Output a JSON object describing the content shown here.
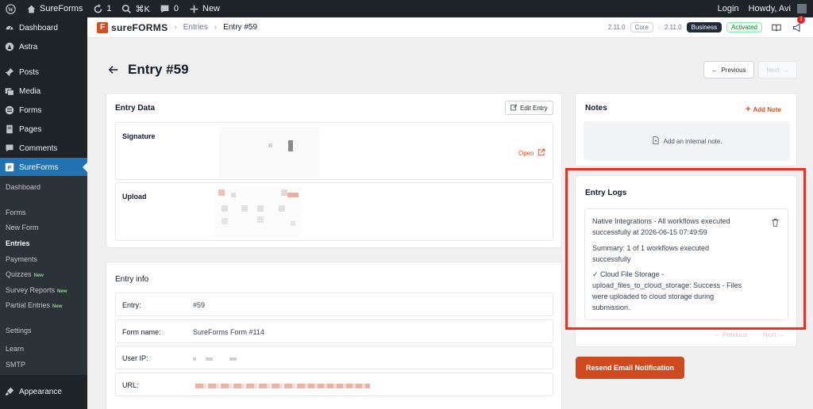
{
  "admin_bar": {
    "site_name": "SureForms",
    "updates_count": "1",
    "search_shortcut": "⌘K",
    "comments_count": "0",
    "new_label": "New",
    "login_label": "Login",
    "howdy_label": "Howdy, Avi"
  },
  "sidebar": {
    "items": [
      {
        "label": "Dashboard",
        "icon": "dashboard-icon"
      },
      {
        "label": "Astra",
        "icon": "astra-icon"
      },
      {
        "label": "Posts",
        "icon": "pin-icon"
      },
      {
        "label": "Media",
        "icon": "media-icon"
      },
      {
        "label": "Forms",
        "icon": "forms-icon"
      },
      {
        "label": "Pages",
        "icon": "pages-icon"
      },
      {
        "label": "Comments",
        "icon": "comments-icon"
      },
      {
        "label": "SureForms",
        "icon": "sureforms-icon"
      }
    ],
    "submenu": [
      {
        "label": "Dashboard",
        "new": ""
      },
      {
        "label": "Forms",
        "new": ""
      },
      {
        "label": "New Form",
        "new": ""
      },
      {
        "label": "Entries",
        "new": ""
      },
      {
        "label": "Payments",
        "new": ""
      },
      {
        "label": "Quizzes",
        "new": "New"
      },
      {
        "label": "Survey Reports",
        "new": "New"
      },
      {
        "label": "Partial Entries",
        "new": "New"
      },
      {
        "label": "Settings",
        "new": ""
      },
      {
        "label": "Learn",
        "new": ""
      },
      {
        "label": "SMTP",
        "new": ""
      }
    ],
    "bottom": {
      "label": "Appearance",
      "icon": "appearance-icon"
    }
  },
  "header": {
    "logo_text": "sureFORMS",
    "breadcrumbs": [
      "Entries",
      "Entry #59"
    ],
    "version_core": "2.11.0",
    "core_label": "Core",
    "version_business": "2.11.0",
    "business_label": "Business",
    "activated_label": "Activated",
    "notification_count": "1"
  },
  "page": {
    "title": "Entry #59",
    "previous_label": "Previous",
    "next_label": "Next"
  },
  "entry_data": {
    "title": "Entry Data",
    "edit_label": "Edit Entry",
    "signature_label": "Signature",
    "open_label": "Open",
    "upload_label": "Upload"
  },
  "entry_info": {
    "title": "Entry info",
    "rows": [
      {
        "label": "Entry:",
        "value": "#59"
      },
      {
        "label": "Form name:",
        "value": "SureForms Form #114"
      },
      {
        "label": "User IP:",
        "value": ""
      },
      {
        "label": "URL:",
        "value": ""
      }
    ]
  },
  "notes": {
    "title": "Notes",
    "add_label": "Add Note",
    "empty_label": "Add an internal note."
  },
  "entry_logs": {
    "title": "Entry Logs",
    "log_title_1": "Native Integrations - All workflows executed",
    "log_title_2": "successfully at 2026-06-15 07:49:59",
    "summary_1": "Summary: 1 of 1 workflows executed",
    "summary_2": "successfully",
    "detail_1": "✓ Cloud File Storage -",
    "detail_2": "upload_files_to_cloud_storage: Success - Files",
    "detail_3": "were uploaded to cloud storage during",
    "detail_4": "submission.",
    "prev_label": "Previous",
    "next_label": "Next"
  },
  "resend_label": "Resend Email Notification",
  "colors": {
    "accent": "#d54e21",
    "wp_blue": "#2271b1",
    "highlight": "#e53126"
  }
}
